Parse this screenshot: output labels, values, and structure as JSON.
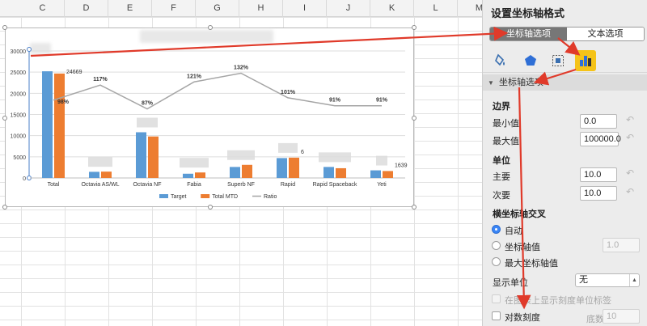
{
  "columns": [
    "C",
    "D",
    "E",
    "F",
    "G",
    "H",
    "I",
    "J",
    "K",
    "L",
    "M"
  ],
  "chart_data": {
    "type": "bar",
    "categories": [
      "Total",
      "Octavia AS/WL",
      "Octavia NF",
      "Fabia",
      "Superb NF",
      "Rapid",
      "Rapid Spaceback",
      "Yeti"
    ],
    "series": [
      {
        "name": "Target",
        "values": [
          25200,
          1450,
          10800,
          1000,
          2600,
          4700,
          2600,
          1800
        ],
        "color": "#5b9bd5"
      },
      {
        "name": "Total MTD",
        "values": [
          24669,
          1500,
          9800,
          1300,
          3100,
          4800,
          2300,
          1639
        ],
        "color": "#ed7d31"
      }
    ],
    "ratio": {
      "name": "Ratio",
      "values": [
        98,
        117,
        87,
        121,
        132,
        101,
        91,
        91
      ],
      "color": "#a5a5a5"
    },
    "data_labels": [
      {
        "text": "24669",
        "series": 1,
        "index": 0
      },
      {
        "text": "98%",
        "series": 2,
        "index": 0
      },
      {
        "text": "117%",
        "series": 2,
        "index": 1
      },
      {
        "text": "87%",
        "series": 2,
        "index": 2
      },
      {
        "text": "121%",
        "series": 2,
        "index": 3
      },
      {
        "text": "132%",
        "series": 2,
        "index": 4
      },
      {
        "text": "101%",
        "series": 2,
        "index": 5
      },
      {
        "text": "91%",
        "series": 2,
        "index": 6
      },
      {
        "text": "91%",
        "series": 2,
        "index": 7
      },
      {
        "text": "6",
        "series": 1,
        "index": 5
      },
      {
        "text": "1639",
        "series": 1,
        "index": 7
      }
    ],
    "y_ticks": [
      0,
      5000,
      10000,
      15000,
      20000,
      25000,
      30000
    ],
    "ylim": [
      0,
      30000
    ],
    "ratio_lim": [
      0,
      160
    ],
    "legend_position": "bottom"
  },
  "panel": {
    "title": "设置坐标轴格式",
    "tabs": [
      "坐标轴选项",
      "文本选项"
    ],
    "section": "坐标轴选项",
    "bounds_head": "边界",
    "min_label": "最小值",
    "min_value": "0.0",
    "max_label": "最大值",
    "max_value": "100000.0",
    "units_head": "单位",
    "major_label": "主要",
    "major_value": "10.0",
    "minor_label": "次要",
    "minor_value": "10.0",
    "cross_head": "横坐标轴交叉",
    "cross_auto": "自动",
    "cross_axis_value": "坐标轴值",
    "cross_axis_value_input": "1.0",
    "cross_max": "最大坐标轴值",
    "display_units_label": "显示单位",
    "display_units_value": "无",
    "show_units_label": "在图表上显示刻度单位标签",
    "log_scale_label": "对数刻度",
    "base_label": "底数",
    "base_value": "10",
    "reset_glyph": "↶"
  },
  "colors": {
    "accent_arrow": "#e03a2a",
    "selected_icon": "#f5c318"
  }
}
